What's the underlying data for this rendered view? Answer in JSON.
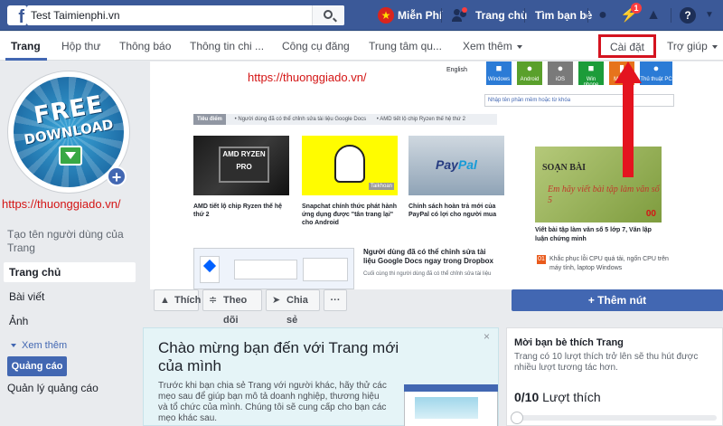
{
  "topbar": {
    "search_value": "Test Taimienphi.vn",
    "logo_letter": "f",
    "links": {
      "free": "Miễn Phí",
      "home": "Trang chủ",
      "find_friends": "Tìm bạn bè"
    },
    "flag_star": "★",
    "messages_badge": "1",
    "help": "?",
    "brand_color": "#3b5998"
  },
  "tabs": {
    "page": "Trang",
    "inbox": "Hộp thư",
    "notifications": "Thông báo",
    "insights": "Thông tin chi ...",
    "publishing_tools": "Công cụ đăng",
    "support_center": "Trung tâm qu...",
    "see_more": "Xem thêm",
    "settings": "Cài đặt",
    "help": "Trợ giúp"
  },
  "left": {
    "avatar_text_1": "FREE",
    "avatar_text_2": "DOWNLOAD",
    "avatar_plus": "+",
    "watermark": "https://thuonggiado.vn/",
    "create_username": "Tạo tên người dùng của Trang",
    "nav": {
      "home": "Trang chủ",
      "posts": "Bài viết",
      "photos": "Ảnh",
      "see_more": "Xem thêm"
    },
    "ads_button": "Quảng cáo",
    "manage_ads": "Quản lý quảng cáo"
  },
  "cover": {
    "watermark": "https://thuonggiado.vn/",
    "english": "English",
    "os_items": [
      {
        "label": "Windows",
        "color": "#2b7bd6"
      },
      {
        "label": "Android",
        "color": "#5aa02c"
      },
      {
        "label": "iOS",
        "color": "#7a7a7a"
      },
      {
        "label": "Win phone",
        "color": "#1c9c3a"
      },
      {
        "label": "Mobile",
        "color": "#e6731c"
      },
      {
        "label": "Thủ thuật PC",
        "color": "#2b7bd6"
      }
    ],
    "search_placeholder": "Nhập tên phần mềm hoặc từ khóa",
    "ticker_label": "Tiêu điểm",
    "ticker_items": [
      "Người dùng đã có thể chỉnh sửa tài liệu Google Docs",
      "AMD tiết lộ chip Ryzen thế hệ thứ 2"
    ],
    "amd_chip": "AMD RYZEN PRO",
    "snap_badge": "Taikhoan",
    "paypal_text_1": "Pay",
    "paypal_text_2": "Pal",
    "articles": [
      "AMD tiết lộ chip Ryzen thế hệ thứ 2",
      "Snapchat chính thức phát hành ứng dụng được \"tân trang lại\" cho Android",
      "Chính sách hoàn trả mới của PayPal có lợi cho người mua"
    ],
    "soanbai_title": "SOẠN BÀI",
    "soanbai_script": "Em hãy viết bài tập làm văn số 5",
    "soanbai_num": "00",
    "right_article": "Viết bài tập làm văn số 5 lớp 7, Văn lập luận chứng minh",
    "right_news_num": "01",
    "right_news": "Khắc phục lỗi CPU quá tải, ngốn CPU trên máy tính, laptop Windows",
    "docs_title": "Người dùng đã có thể chỉnh sửa tài liệu Google Docs ngay trong Dropbox",
    "docs_sub": "Cuối cùng thì người dùng đã có thể chỉnh sửa tài liệu"
  },
  "actions": {
    "like": "Thích",
    "follow": "Theo dõi",
    "share": "Chia sẻ",
    "more": "···",
    "add_button": "+ Thêm nút"
  },
  "welcome": {
    "title": "Chào mừng bạn đến với Trang mới của mình",
    "body": "Trước khi bạn chia sẻ Trang với người khác, hãy thử các mẹo sau để giúp bạn mô tả doanh nghiệp, thương hiệu và tổ chức của mình. Chúng tôi sẽ cung cấp cho bạn các mẹo khác sau.",
    "close": "×"
  },
  "likes": {
    "title": "Mời bạn bè thích Trang",
    "subtitle": "Trang có 10 lượt thích trở lên sẽ thu hút được nhiều lượt tương tác hơn.",
    "count": "0/10",
    "count_label": "Lượt thích",
    "progress": 0
  },
  "annotation": {
    "highlight_color": "#d4131f"
  }
}
